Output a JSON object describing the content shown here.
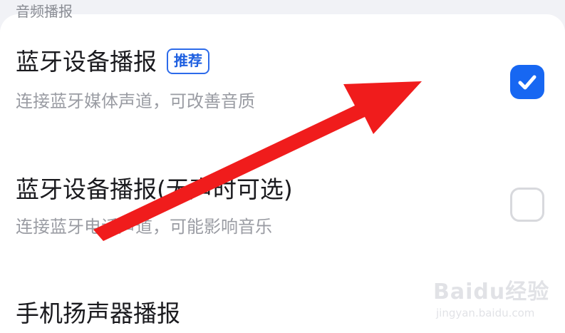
{
  "header": {
    "partial_title": "音频播报"
  },
  "options": [
    {
      "title": "蓝牙设备播报",
      "badge": "推荐",
      "subtitle": "连接蓝牙媒体声道，可改善音质",
      "checked": true
    },
    {
      "title": "蓝牙设备播报(无声时可选)",
      "subtitle": "连接蓝牙电话声道，可能影响音乐",
      "checked": false
    },
    {
      "title": "手机扬声器播报"
    }
  ],
  "overlay": {
    "arrow_color": "#f01c1c"
  },
  "watermark": {
    "logo": "Baidu经验",
    "url": "jingyan.baidu.com"
  },
  "colors": {
    "accent": "#1767f2",
    "title_text": "#1b1b1f",
    "subtitle_text": "#9a9ca3",
    "background": "#f1f2f6",
    "card": "#ffffff"
  }
}
